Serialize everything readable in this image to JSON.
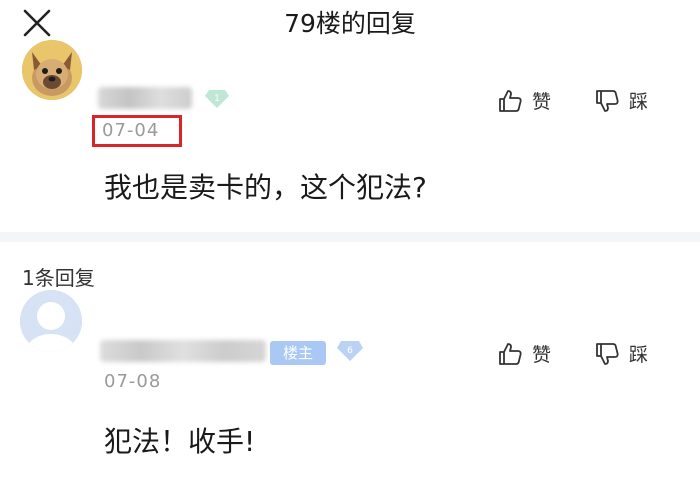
{
  "header": {
    "title": "79楼的回复",
    "close_icon": "close-icon"
  },
  "main_comment": {
    "avatar_icon": "dog-avatar-icon",
    "level": "1",
    "date": "07-04",
    "like_label": "赞",
    "dislike_label": "踩",
    "content": "我也是卖卡的，这个犯法?"
  },
  "replies_section": {
    "count_label": "1条回复"
  },
  "reply": {
    "avatar_icon": "default-avatar-icon",
    "badge": "楼主",
    "level": "6",
    "date": "07-08",
    "like_label": "赞",
    "dislike_label": "踩",
    "content": "犯法！收手!"
  },
  "colors": {
    "highlight_box": "#d9252a",
    "level_gem_1": "#bfe6d6",
    "level_gem_6": "#bcd2f5",
    "op_badge": "#a9c8f3",
    "date_text": "#9a9a9a"
  }
}
